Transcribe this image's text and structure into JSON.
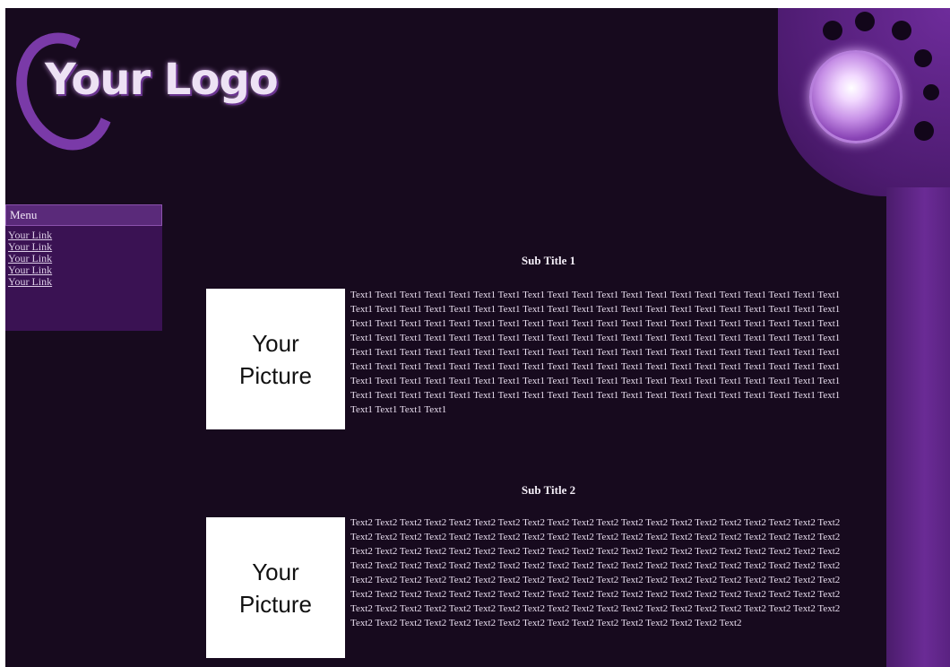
{
  "logo": {
    "text": "Your Logo"
  },
  "menu": {
    "header": "Menu",
    "links": [
      "Your Link",
      "Your Link",
      "Your Link",
      "Your Link",
      "Your Link"
    ]
  },
  "sections": [
    {
      "title": "Sub Title 1",
      "picture_lines": [
        "Your",
        "Picture"
      ],
      "text": "Text1 Text1 Text1 Text1 Text1 Text1 Text1 Text1 Text1 Text1 Text1 Text1 Text1 Text1 Text1 Text1 Text1 Text1 Text1 Text1 Text1 Text1 Text1 Text1 Text1 Text1 Text1 Text1 Text1 Text1 Text1 Text1 Text1 Text1 Text1 Text1 Text1 Text1 Text1 Text1 Text1 Text1 Text1 Text1 Text1 Text1 Text1 Text1 Text1 Text1 Text1 Text1 Text1 Text1 Text1 Text1 Text1 Text1 Text1 Text1 Text1 Text1 Text1 Text1 Text1 Text1 Text1 Text1 Text1 Text1 Text1 Text1 Text1 Text1 Text1 Text1 Text1 Text1 Text1 Text1 Text1 Text1 Text1 Text1 Text1 Text1 Text1 Text1 Text1 Text1 Text1 Text1 Text1 Text1 Text1 Text1 Text1 Text1 Text1 Text1 Text1 Text1 Text1 Text1 Text1 Text1 Text1 Text1 Text1 Text1 Text1 Text1 Text1 Text1 Text1 Text1 Text1 Text1 Text1 Text1 Text1 Text1 Text1 Text1 Text1 Text1 Text1 Text1 Text1 Text1 Text1 Text1 Text1 Text1 Text1 Text1 Text1 Text1 Text1 Text1 Text1 Text1 Text1 Text1 Text1 Text1 Text1 Text1 Text1 Text1 Text1 Text1 Text1 Text1 Text1 Text1 Text1 Text1 Text1 Text1 Text1 Text1 Text1 Text1"
    },
    {
      "title": "Sub Title 2",
      "picture_lines": [
        "Your",
        "Picture"
      ],
      "text": "Text2 Text2 Text2 Text2 Text2 Text2 Text2 Text2 Text2 Text2 Text2 Text2 Text2 Text2 Text2 Text2 Text2 Text2 Text2 Text2 Text2 Text2 Text2 Text2 Text2 Text2 Text2 Text2 Text2 Text2 Text2 Text2 Text2 Text2 Text2 Text2 Text2 Text2 Text2 Text2 Text2 Text2 Text2 Text2 Text2 Text2 Text2 Text2 Text2 Text2 Text2 Text2 Text2 Text2 Text2 Text2 Text2 Text2 Text2 Text2 Text2 Text2 Text2 Text2 Text2 Text2 Text2 Text2 Text2 Text2 Text2 Text2 Text2 Text2 Text2 Text2 Text2 Text2 Text2 Text2 Text2 Text2 Text2 Text2 Text2 Text2 Text2 Text2 Text2 Text2 Text2 Text2 Text2 Text2 Text2 Text2 Text2 Text2 Text2 Text2 Text2 Text2 Text2 Text2 Text2 Text2 Text2 Text2 Text2 Text2 Text2 Text2 Text2 Text2 Text2 Text2 Text2 Text2 Text2 Text2 Text2 Text2 Text2 Text2 Text2 Text2 Text2 Text2 Text2 Text2 Text2 Text2 Text2 Text2 Text2 Text2 Text2 Text2 Text2 Text2 Text2 Text2 Text2 Text2 Text2 Text2 Text2 Text2 Text2 Text2 Text2 Text2 Text2 Text2 Text2 Text2"
    }
  ]
}
